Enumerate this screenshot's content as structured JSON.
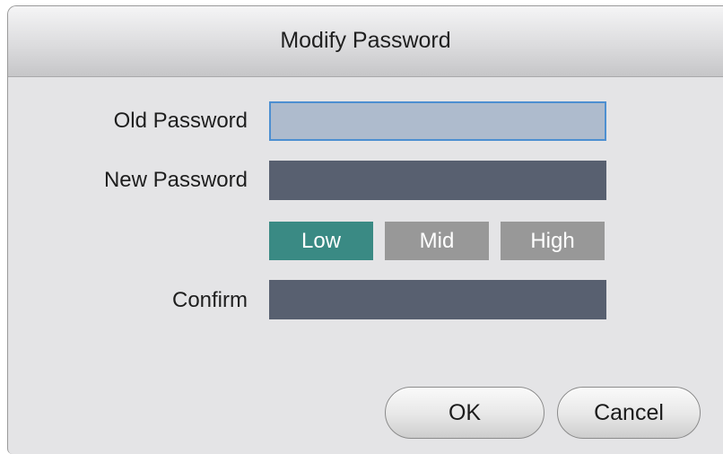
{
  "dialog": {
    "title": "Modify Password"
  },
  "fields": {
    "old_password": {
      "label": "Old Password",
      "value": ""
    },
    "new_password": {
      "label": "New Password",
      "value": ""
    },
    "confirm": {
      "label": "Confirm",
      "value": ""
    }
  },
  "strength": {
    "levels": [
      "Low",
      "Mid",
      "High"
    ],
    "current": "Low"
  },
  "buttons": {
    "ok_label": "OK",
    "cancel_label": "Cancel"
  },
  "colors": {
    "field_dark": "#586070",
    "field_focused": "#aebbcd",
    "focus_border": "#4d8fd1",
    "strength_active": "#3a8a84",
    "strength_inactive": "#989898",
    "dialog_background": "#e4e4e6"
  }
}
